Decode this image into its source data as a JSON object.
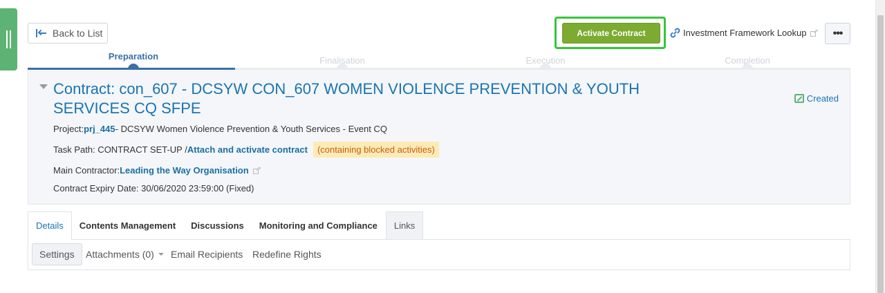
{
  "toolbar": {
    "back_label": "Back to List",
    "activate_label": "Activate Contract",
    "ifl_label": "Investment Framework Lookup",
    "more_label": "•••"
  },
  "stepper": {
    "steps": [
      {
        "label": "Preparation",
        "active": true
      },
      {
        "label": "Finalisation",
        "active": false
      },
      {
        "label": "Execution",
        "active": false
      },
      {
        "label": "Completion",
        "active": false
      }
    ]
  },
  "contract": {
    "title": "Contract: con_607 - DCSYW CON_607 WOMEN VIOLENCE PREVENTION & YOUTH SERVICES CQ SFPE",
    "status": "Created",
    "project_label": "Project:",
    "project_link": "prj_445",
    "project_rest": "- DCSYW Women Violence Prevention & Youth Services - Event CQ",
    "task_label": "Task Path: CONTRACT SET-UP /",
    "task_link": "Attach and activate contract",
    "task_warning": "(containing blocked activities)",
    "contractor_label": "Main Contractor:",
    "contractor_link": "Leading the Way Organisation",
    "expiry": "Contract Expiry Date: 30/06/2020 23:59:00 (Fixed)"
  },
  "tabs": [
    "Details",
    "Contents Management",
    "Discussions",
    "Monitoring and Compliance",
    "Links"
  ],
  "subtabs": {
    "settings": "Settings",
    "attachments": "Attachments (0)",
    "email": "Email Recipients",
    "redefine": "Redefine Rights"
  },
  "colors": {
    "accent": "#1a74b0",
    "activate": "#7dab32",
    "highlight": "#34c63a",
    "warning_bg": "#fdebb6",
    "warning_fg": "#c85d10"
  }
}
